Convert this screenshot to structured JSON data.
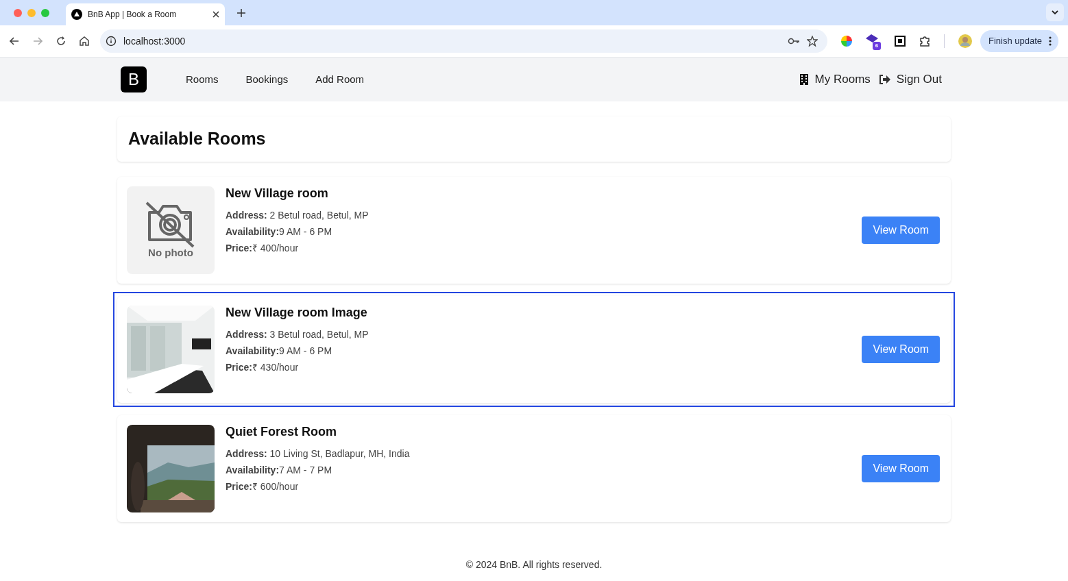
{
  "browser": {
    "tab": {
      "title": "BnB App | Book a Room"
    },
    "url": "localhost:3000",
    "extension_badge": "6",
    "update_button": "Finish update"
  },
  "nav": {
    "logo": "B",
    "links": [
      {
        "label": "Rooms"
      },
      {
        "label": "Bookings"
      },
      {
        "label": "Add Room"
      }
    ],
    "actions": [
      {
        "kind": "rooms",
        "label": "My Rooms"
      },
      {
        "kind": "signout",
        "label": "Sign Out"
      }
    ]
  },
  "heading": "Available Rooms",
  "rooms": [
    {
      "name": "New Village room",
      "image": {
        "kind": "placeholder",
        "text": "No photo"
      },
      "address": "**Address:** 2 Betul road, Betul, MP",
      "availability": "**Availability:**9 AM - 6 PM",
      "price": "**Price:**₹ 400/hour",
      "button": "View Room",
      "focused": false
    },
    {
      "name": "New Village room Image",
      "image": {
        "kind": "office"
      },
      "address": "**Address:** 3 Betul road, Betul, MP",
      "availability": "**Availability:**9 AM - 6 PM",
      "price": "**Price:**₹ 430/hour",
      "button": "View Room",
      "focused": true
    },
    {
      "name": "Quiet Forest Room",
      "image": {
        "kind": "landscape"
      },
      "address": "**Address:** 10 Living St, Badlapur, MH, India",
      "availability": "**Availability:**7 AM - 7 PM",
      "price": "**Price:**₹ 600/hour",
      "button": "View Room",
      "focused": false
    }
  ],
  "footer": "© 2024 BnB. All rights reserved."
}
